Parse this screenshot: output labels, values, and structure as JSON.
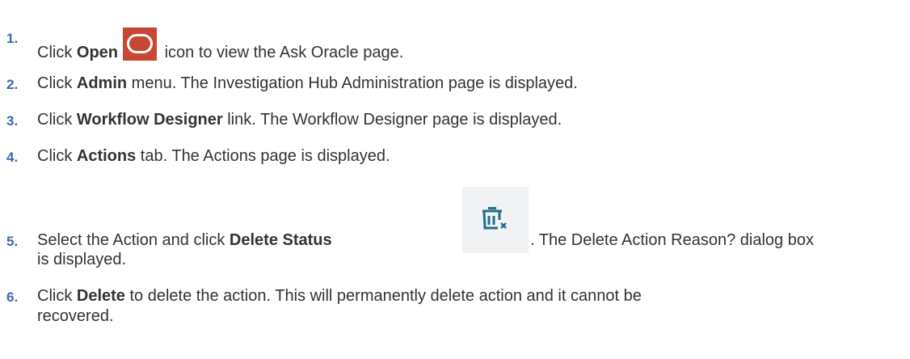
{
  "steps": [
    {
      "num": "1.",
      "pre": "Click ",
      "bold": "Open",
      "post": " icon to view the Ask Oracle page.",
      "icon": "oracle-open-icon"
    },
    {
      "num": "2.",
      "pre": "Click ",
      "bold": "Admin",
      "post": " menu. The Investigation Hub Administration page is displayed."
    },
    {
      "num": "3.",
      "pre": "Click ",
      "bold": "Workflow Designer",
      "post": " link. The Workflow Designer page is displayed."
    },
    {
      "num": "4.",
      "pre": "Click ",
      "bold": "Actions",
      "post": " tab. The Actions page is displayed."
    },
    {
      "num": "5.",
      "pre": "Select the Action and click ",
      "bold": "Delete Status",
      "post": ". The Delete Action Reason? dialog box",
      "line2": "is displayed.",
      "icon": "delete-status-icon"
    },
    {
      "num": "6.",
      "pre": "Click ",
      "bold": "Delete",
      "post": " to delete the action. This will permanently delete action and it cannot be",
      "line2": "recovered."
    }
  ],
  "colors": {
    "number": "#3a6aa8",
    "text": "#333333",
    "oracle_red": "#c74634",
    "delete_icon": "#1f6f8b"
  }
}
